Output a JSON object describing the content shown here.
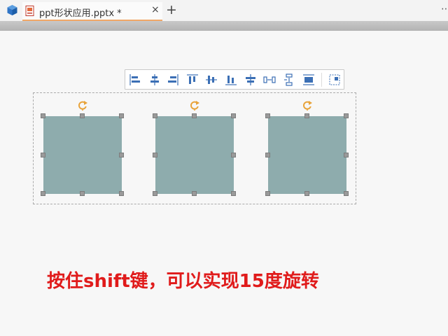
{
  "app": {
    "icon": "wps-cube-icon",
    "accent_color": "#f0a766"
  },
  "tab": {
    "title": "ppt形状应用.pptx *",
    "close_label": "×",
    "file_icon": "presentation-file-icon"
  },
  "new_tab_label": "+",
  "window_menu_label": "⋯",
  "align_toolbar": {
    "buttons": [
      "align-left-icon",
      "align-center-horizontal-icon",
      "align-right-icon",
      "align-top-icon",
      "align-middle-vertical-icon",
      "align-bottom-icon",
      "distribute-horizontal-icon",
      "distribute-horizontal-space-icon",
      "distribute-vertical-icon",
      "distribute-vertical-space-icon",
      "more-options-icon"
    ]
  },
  "shapes": {
    "count": 3,
    "fill_color": "#8eacad",
    "handle_color": "#9a9a9a",
    "rotate_handle_color": "#e8a33a"
  },
  "caption": {
    "text": "按住shift键，可以实现15度旋转",
    "color": "#e01b1b"
  }
}
